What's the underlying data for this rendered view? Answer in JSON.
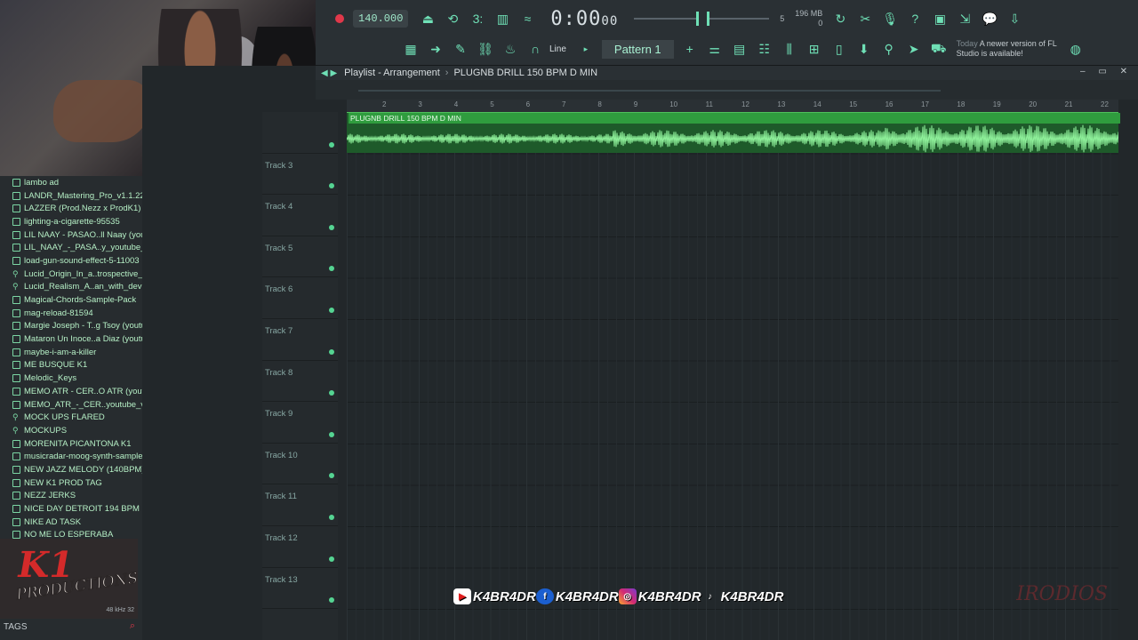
{
  "toolbar": {
    "tempo": "140.000",
    "time_main": "0:00",
    "time_sub": "00",
    "cpu_value": "5",
    "ram_value": "196 MB",
    "voices": "0",
    "snap_mode": "Line",
    "pattern": "Pattern 1",
    "news_when": "Today",
    "news_text": "A newer version of FL Studio is available!",
    "accent_color": "#6fe0b6"
  },
  "playlist": {
    "title_prefix": "Playlist - Arrangement",
    "project_name": "PLUGNB DRILL 150 BPM D MIN",
    "clip_label": "PLUGNB DRILL 150 BPM D MIN",
    "ruler": [
      "2",
      "3",
      "4",
      "5",
      "6",
      "7",
      "8",
      "9",
      "10",
      "11",
      "12",
      "13",
      "14",
      "15",
      "16",
      "17",
      "18",
      "19",
      "20",
      "21",
      "22"
    ],
    "tracks": [
      "Track 3",
      "Track 4",
      "Track 5",
      "Track 6",
      "Track 7",
      "Track 8",
      "Track 9",
      "Track 10",
      "Track 11",
      "Track 12",
      "Track 13"
    ]
  },
  "browser": {
    "items": [
      {
        "label": "lambo ad",
        "type": "file"
      },
      {
        "label": "LANDR_Mastering_Pro_v1.1.22",
        "type": "file"
      },
      {
        "label": "LAZZER (Prod.Nezz x ProdK1)",
        "type": "file"
      },
      {
        "label": "lighting-a-cigarette-95535",
        "type": "file"
      },
      {
        "label": "LIL NAAY - PASAO..ll Naay (youtube)",
        "type": "file"
      },
      {
        "label": "LIL_NAAY_-_PASA..y_youtube_vocal",
        "type": "file"
      },
      {
        "label": "load-gun-sound-effect-5-11003",
        "type": "file"
      },
      {
        "label": "Lucid_Origin_In_a..trospective_li_0",
        "type": "folder"
      },
      {
        "label": "Lucid_Realism_A..an_with_devil_1",
        "type": "folder"
      },
      {
        "label": "Magical-Chords-Sample-Pack",
        "type": "file"
      },
      {
        "label": "mag-reload-81594",
        "type": "file"
      },
      {
        "label": "Margie Joseph - T..g Tsoy (youtube)",
        "type": "file"
      },
      {
        "label": "Mataron Un Inoce..a Diaz (youtube)",
        "type": "file"
      },
      {
        "label": "maybe-i-am-a-killer",
        "type": "file"
      },
      {
        "label": "ME BUSQUE K1",
        "type": "file"
      },
      {
        "label": "Melodic_Keys",
        "type": "file"
      },
      {
        "label": "MEMO ATR - CER..O ATR (youtube)",
        "type": "file"
      },
      {
        "label": "MEMO_ATR_-_CER..youtube_vocal",
        "type": "file"
      },
      {
        "label": "MOCK UPS FLARED",
        "type": "folder"
      },
      {
        "label": "MOCKUPS",
        "type": "folder"
      },
      {
        "label": "MORENITA PICANTONA K1",
        "type": "file"
      },
      {
        "label": "musicradar-moog-synth-samples",
        "type": "file"
      },
      {
        "label": "NEW JAZZ MELODY (140BPM)",
        "type": "file"
      },
      {
        "label": "NEW K1 PROD TAG",
        "type": "file"
      },
      {
        "label": "NEZZ JERKS",
        "type": "file"
      },
      {
        "label": "NICE DAY DETROIT 194 BPM B MIN",
        "type": "file"
      },
      {
        "label": "NIKE AD TASK",
        "type": "file"
      },
      {
        "label": "NO ME LO ESPERABA",
        "type": "file"
      }
    ],
    "logo_mark": "K1",
    "logo_text": "PRODUCTIONS",
    "sample_rate": "48 kHz 32",
    "tags_label": "TAGS"
  },
  "social": {
    "handles": [
      "K4BR4DR",
      "K4BR4DR",
      "K4BR4DR",
      "K4BR4DR"
    ],
    "icons": [
      "youtube-icon",
      "facebook-icon",
      "instagram-icon",
      "tiktok-icon"
    ]
  },
  "watermark": "IRODIOS"
}
